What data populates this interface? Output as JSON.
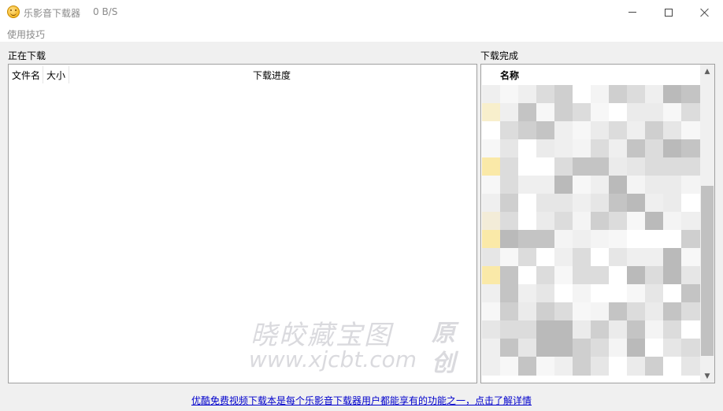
{
  "window": {
    "title": "乐影音下载器",
    "speed": "0 B/S"
  },
  "menu": {
    "tips": "使用技巧"
  },
  "downloading": {
    "label": "正在下载",
    "columns": [
      "文件名",
      "大小",
      "下载进度"
    ]
  },
  "completed": {
    "label": "下载完成",
    "column_name": "名称"
  },
  "watermark": {
    "line1": "晓皎藏宝图",
    "line2": "www.xjcbt.com",
    "side1": "原",
    "side2": "创"
  },
  "footer": {
    "link_text": "优酷免费视频下载本是每个乐影音下载器用户都能享有的功能之一，点击了解详情"
  }
}
